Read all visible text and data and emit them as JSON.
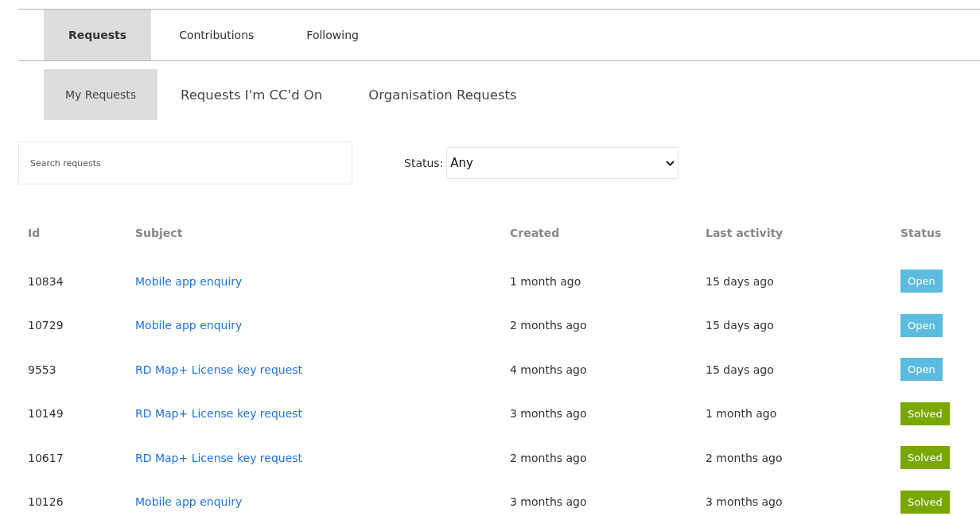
{
  "tabs": [
    {
      "label": "Requests",
      "selected": true
    },
    {
      "label": "Contributions",
      "selected": false
    },
    {
      "label": "Following",
      "selected": false
    }
  ],
  "subtabs": [
    {
      "label": "My Requests",
      "selected": true
    },
    {
      "label": "Requests I'm CC'd On",
      "selected": false
    },
    {
      "label": "Organisation Requests",
      "selected": false
    }
  ],
  "search": {
    "placeholder": "Search requests"
  },
  "status_filter": {
    "label": "Status:",
    "value": "Any"
  },
  "table": {
    "columns": [
      "Id",
      "Subject",
      "Created",
      "Last activity",
      "Status"
    ],
    "rows": [
      {
        "id": "10834",
        "subject": "Mobile app enquiry",
        "created": "1 month ago",
        "last_activity": "15 days ago",
        "status": "Open",
        "color": "#5bbce0"
      },
      {
        "id": "10729",
        "subject": "Mobile app enquiry",
        "created": "2 months ago",
        "last_activity": "15 days ago",
        "status": "Open",
        "color": "#5bbce0"
      },
      {
        "id": "9553",
        "subject": "RD Map+ License key request",
        "created": "4 months ago",
        "last_activity": "15 days ago",
        "status": "Open",
        "color": "#5bbce0"
      },
      {
        "id": "10149",
        "subject": "RD Map+ License key request",
        "created": "3 months ago",
        "last_activity": "1 month ago",
        "status": "Solved",
        "color": "#7aa600"
      },
      {
        "id": "10617",
        "subject": "RD Map+ License key request",
        "created": "2 months ago",
        "last_activity": "2 months ago",
        "status": "Solved",
        "color": "#7aa600"
      },
      {
        "id": "10126",
        "subject": "Mobile app enquiry",
        "created": "3 months ago",
        "last_activity": "3 months ago",
        "status": "Solved",
        "color": "#7aa600"
      }
    ]
  }
}
